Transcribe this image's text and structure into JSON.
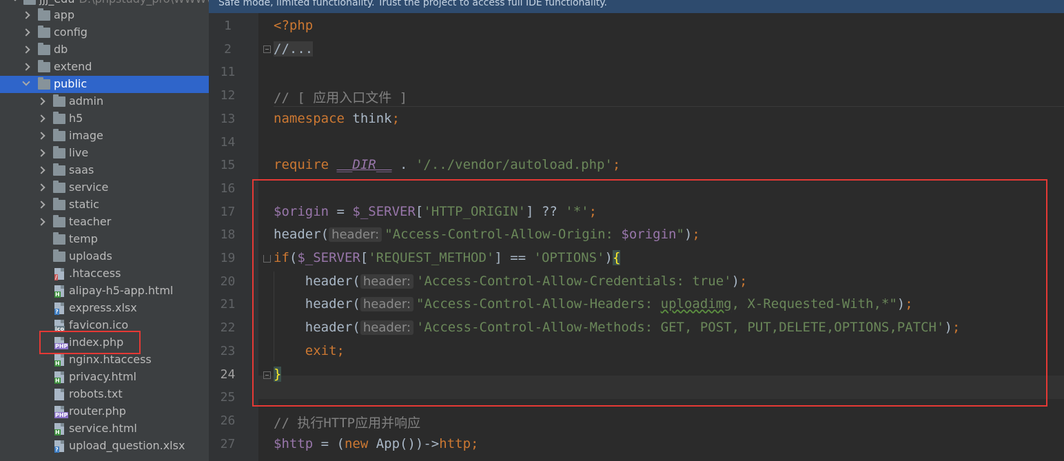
{
  "project": {
    "root_name": "jjj_edu",
    "root_path": "D:\\phpstudy_pro\\WWW\\jjj_edu",
    "items": [
      {
        "label": "app",
        "kind": "folder",
        "state": "collapsed",
        "depth": 1
      },
      {
        "label": "config",
        "kind": "folder",
        "state": "collapsed",
        "depth": 1
      },
      {
        "label": "db",
        "kind": "folder",
        "state": "collapsed",
        "depth": 1
      },
      {
        "label": "extend",
        "kind": "folder",
        "state": "collapsed",
        "depth": 1
      },
      {
        "label": "public",
        "kind": "folder",
        "state": "expanded",
        "depth": 1,
        "selected": true
      },
      {
        "label": "admin",
        "kind": "folder",
        "state": "collapsed",
        "depth": 2
      },
      {
        "label": "h5",
        "kind": "folder",
        "state": "collapsed",
        "depth": 2
      },
      {
        "label": "image",
        "kind": "folder",
        "state": "collapsed",
        "depth": 2
      },
      {
        "label": "live",
        "kind": "folder",
        "state": "collapsed",
        "depth": 2
      },
      {
        "label": "saas",
        "kind": "folder",
        "state": "collapsed",
        "depth": 2
      },
      {
        "label": "service",
        "kind": "folder",
        "state": "collapsed",
        "depth": 2
      },
      {
        "label": "static",
        "kind": "folder",
        "state": "collapsed",
        "depth": 2
      },
      {
        "label": "teacher",
        "kind": "folder",
        "state": "collapsed",
        "depth": 2
      },
      {
        "label": "temp",
        "kind": "folder",
        "state": "none",
        "depth": 2
      },
      {
        "label": "uploads",
        "kind": "folder",
        "state": "none",
        "depth": 2
      },
      {
        "label": ".htaccess",
        "kind": "htaccess-file",
        "depth": 2
      },
      {
        "label": "alipay-h5-app.html",
        "kind": "html-file",
        "depth": 2
      },
      {
        "label": "express.xlsx",
        "kind": "xlsx-file",
        "depth": 2
      },
      {
        "label": "favicon.ico",
        "kind": "ico-file",
        "depth": 2
      },
      {
        "label": "index.php",
        "kind": "php-file",
        "depth": 2,
        "highlighted": true
      },
      {
        "label": "nginx.htaccess",
        "kind": "html-file",
        "depth": 2
      },
      {
        "label": "privacy.html",
        "kind": "html-file",
        "depth": 2
      },
      {
        "label": "robots.txt",
        "kind": "text-file",
        "depth": 2
      },
      {
        "label": "router.php",
        "kind": "php-file",
        "depth": 2
      },
      {
        "label": "service.html",
        "kind": "html-file",
        "depth": 2
      },
      {
        "label": "upload_question.xlsx",
        "kind": "xlsx-file",
        "depth": 2
      }
    ]
  },
  "banner": {
    "text": "Safe mode, limited functionality. Trust the project to access full IDE functionality."
  },
  "editor": {
    "current_line": "24",
    "lines": [
      {
        "no": "1",
        "segments": [
          {
            "t": "<?php",
            "c": "kw"
          }
        ]
      },
      {
        "no": "2",
        "segments": [
          {
            "t": "//...",
            "c": "collapsed-text"
          }
        ]
      },
      {
        "no": "11",
        "segments": []
      },
      {
        "no": "12",
        "segments": [
          {
            "t": "// [ 应用入口文件 ]",
            "c": "cmt"
          }
        ]
      },
      {
        "no": "13",
        "segments": [
          {
            "t": "namespace",
            "c": "kw"
          },
          {
            "t": " think",
            "c": ""
          },
          {
            "t": ";",
            "c": "kw"
          }
        ]
      },
      {
        "no": "14",
        "segments": []
      },
      {
        "no": "15",
        "segments": [
          {
            "t": "require",
            "c": "kw"
          },
          {
            "t": " ",
            "c": ""
          },
          {
            "t": "__DIR__",
            "c": "const"
          },
          {
            "t": " . ",
            "c": ""
          },
          {
            "t": "'/../vendor/autoload.php'",
            "c": "str"
          },
          {
            "t": ";",
            "c": "kw"
          }
        ]
      },
      {
        "no": "16",
        "segments": []
      },
      {
        "no": "17",
        "segments": [
          {
            "t": "$origin",
            "c": "var"
          },
          {
            "t": " = ",
            "c": ""
          },
          {
            "t": "$_SERVER",
            "c": "var"
          },
          {
            "t": "[",
            "c": ""
          },
          {
            "t": "'HTTP_ORIGIN'",
            "c": "str"
          },
          {
            "t": "] ?? ",
            "c": ""
          },
          {
            "t": "'*'",
            "c": "str"
          },
          {
            "t": ";",
            "c": "kw"
          }
        ]
      },
      {
        "no": "18",
        "segments": [
          {
            "t": "header(",
            "c": ""
          },
          {
            "t": "header:",
            "c": "hint"
          },
          {
            "t": "\"Access-Control-Allow-Origin: ",
            "c": "str"
          },
          {
            "t": "$origin",
            "c": "var"
          },
          {
            "t": "\"",
            "c": "str"
          },
          {
            "t": ")",
            "c": ""
          },
          {
            "t": ";",
            "c": "kw"
          }
        ]
      },
      {
        "no": "19",
        "segments": [
          {
            "t": "if",
            "c": "kw"
          },
          {
            "t": "(",
            "c": ""
          },
          {
            "t": "$_SERVER",
            "c": "var"
          },
          {
            "t": "[",
            "c": ""
          },
          {
            "t": "'REQUEST_METHOD'",
            "c": "str"
          },
          {
            "t": "] == ",
            "c": ""
          },
          {
            "t": "'OPTIONS'",
            "c": "str"
          },
          {
            "t": ")",
            "c": ""
          },
          {
            "t": "{",
            "c": "bracematch"
          }
        ]
      },
      {
        "no": "20",
        "segments": [
          {
            "t": "    header(",
            "c": ""
          },
          {
            "t": "header:",
            "c": "hint"
          },
          {
            "t": "'Access-Control-Allow-Credentials: true'",
            "c": "str"
          },
          {
            "t": ")",
            "c": ""
          },
          {
            "t": ";",
            "c": "kw"
          }
        ]
      },
      {
        "no": "21",
        "segments": [
          {
            "t": "    header(",
            "c": ""
          },
          {
            "t": "header:",
            "c": "hint"
          },
          {
            "t": "\"Access-Control-Allow-Headers: ",
            "c": "str"
          },
          {
            "t": "uploadimg",
            "c": "str typo"
          },
          {
            "t": ", X-Requested-With,*\"",
            "c": "str"
          },
          {
            "t": ")",
            "c": ""
          },
          {
            "t": ";",
            "c": "kw"
          }
        ]
      },
      {
        "no": "22",
        "segments": [
          {
            "t": "    header(",
            "c": ""
          },
          {
            "t": "header:",
            "c": "hint"
          },
          {
            "t": "'Access-Control-Allow-Methods: GET, POST, PUT,DELETE,OPTIONS,PATCH'",
            "c": "str"
          },
          {
            "t": ")",
            "c": ""
          },
          {
            "t": ";",
            "c": "kw"
          }
        ]
      },
      {
        "no": "23",
        "segments": [
          {
            "t": "    exit",
            "c": "kw"
          },
          {
            "t": ";",
            "c": "kw"
          }
        ]
      },
      {
        "no": "24",
        "segments": [
          {
            "t": "}",
            "c": "bracematch"
          }
        ]
      },
      {
        "no": "25",
        "segments": []
      },
      {
        "no": "26",
        "segments": [
          {
            "t": "// 执行HTTP应用并响应",
            "c": "cmt"
          }
        ]
      },
      {
        "no": "27",
        "segments": [
          {
            "t": "$http",
            "c": "var"
          },
          {
            "t": " = (",
            "c": ""
          },
          {
            "t": "new",
            "c": "kw"
          },
          {
            "t": " App())->",
            "c": ""
          },
          {
            "t": "http",
            "c": "kw"
          },
          {
            "t": ";",
            "c": "kw"
          }
        ]
      }
    ]
  }
}
